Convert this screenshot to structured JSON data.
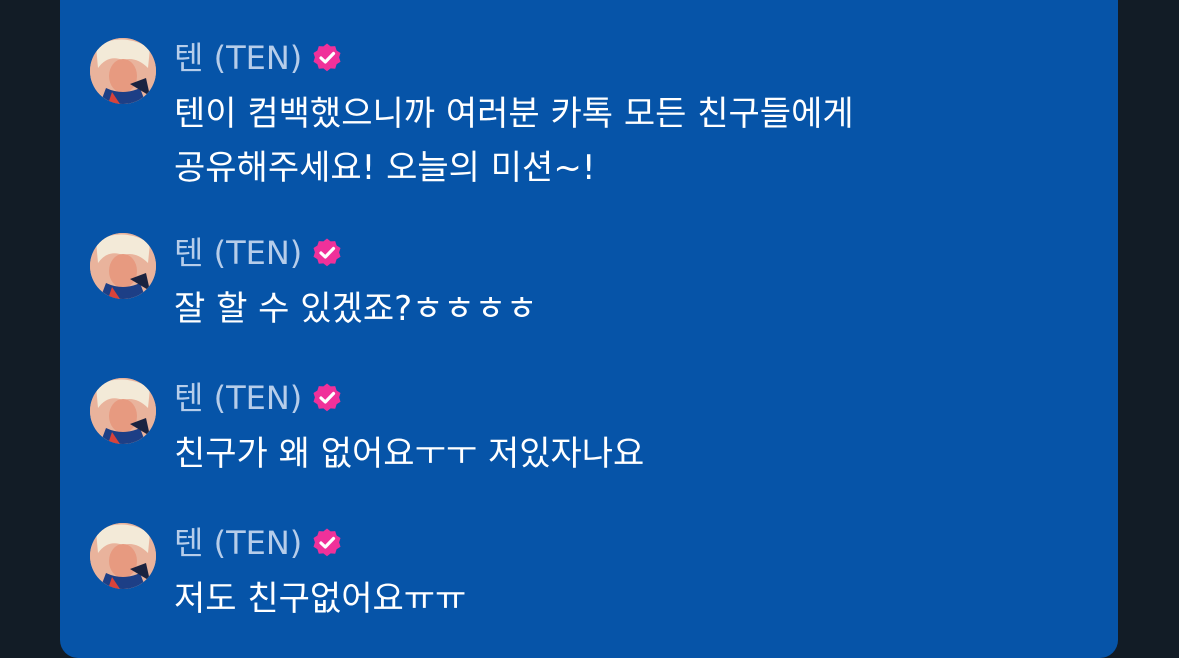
{
  "colors": {
    "background": "#121c26",
    "panel": "#0654a8",
    "name_text": "#b6cdea",
    "message_text": "#ffffff",
    "verified_badge": "#f0319a"
  },
  "messages": [
    {
      "author": "텐 (TEN)",
      "badge_icon": "verified-badge-icon",
      "text": "텐이 컴백했으니까 여러분 카톡 모든 친구들에게 공유해주세요! 오늘의 미션~!"
    },
    {
      "author": "텐 (TEN)",
      "badge_icon": "verified-badge-icon",
      "text": "잘 할 수 있겠죠?ㅎㅎㅎㅎ"
    },
    {
      "author": "텐 (TEN)",
      "badge_icon": "verified-badge-icon",
      "text": "친구가 왜 없어요ㅜㅜ 저있자나요"
    },
    {
      "author": "텐 (TEN)",
      "badge_icon": "verified-badge-icon",
      "text": "저도 친구없어요ㅠㅠ"
    }
  ]
}
